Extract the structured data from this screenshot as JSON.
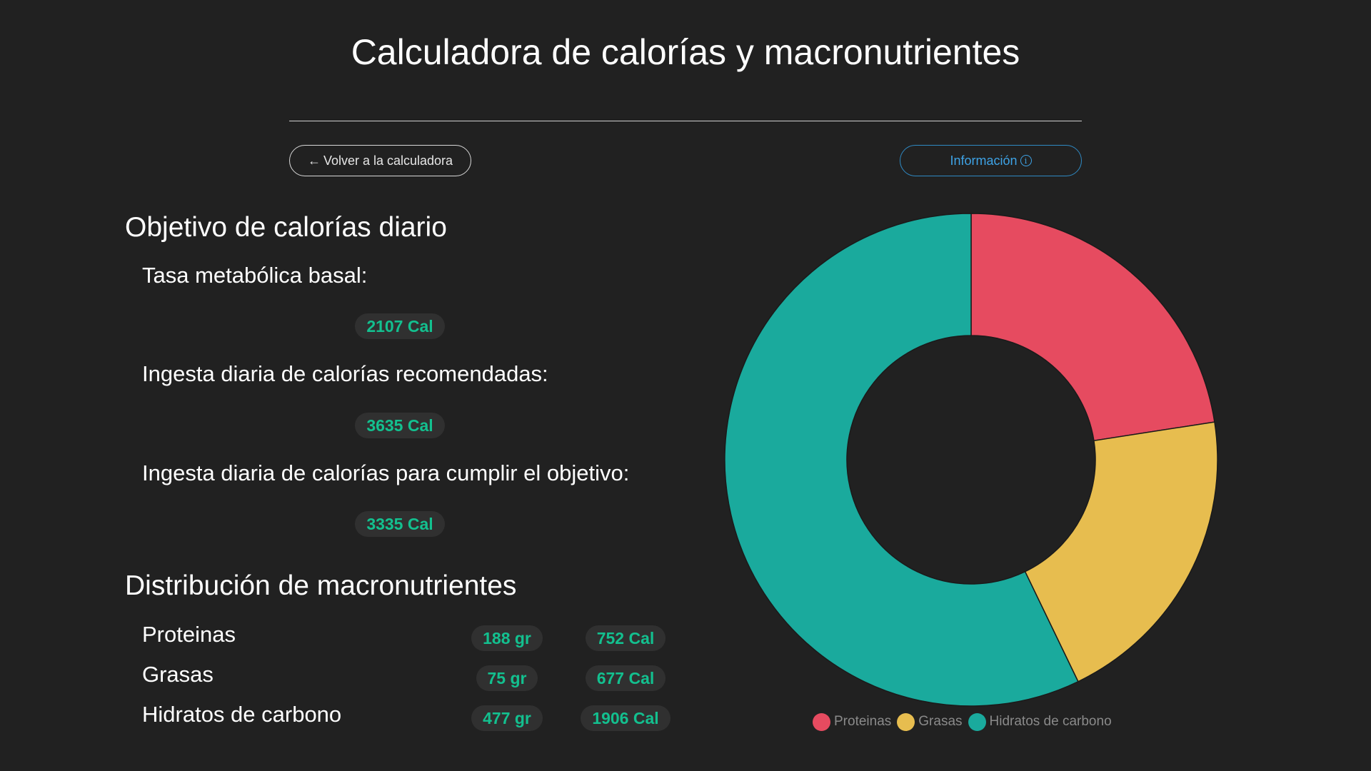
{
  "header": {
    "title": "Calculadora de calorías y macronutrientes"
  },
  "toolbar": {
    "back_label": "Volver a la calculadora",
    "info_label": "Información"
  },
  "icons": {
    "back": "arrow-left-icon",
    "info": "info-circle-icon"
  },
  "calories": {
    "heading": "Objetivo de calorías diario",
    "bmr_label": "Tasa metabólica basal:",
    "bmr_value": "2107 Cal",
    "recommended_label": "Ingesta diaria de calorías recomendadas:",
    "recommended_value": "3635 Cal",
    "goal_label": "Ingesta diaria de calorías para cumplir el objetivo:",
    "goal_value": "3335 Cal"
  },
  "macros": {
    "heading": "Distribución de macronutrientes",
    "rows": [
      {
        "name": "Proteinas",
        "grams": "188 gr",
        "calories": "752 Cal"
      },
      {
        "name": "Grasas",
        "grams": "75 gr",
        "calories": "677 Cal"
      },
      {
        "name": "Hidratos de carbono",
        "grams": "477 gr",
        "calories": "1906 Cal"
      }
    ]
  },
  "colors": {
    "background": "#212121",
    "accent_value": "#13c08f",
    "info_blue": "#3ea3e6",
    "proteinas": "#e64b60",
    "grasas": "#e7bd4f",
    "hidratos": "#1aaa9d"
  },
  "chart_data": {
    "type": "pie",
    "variant": "doughnut",
    "categories": [
      "Proteinas",
      "Grasas",
      "Hidratos de carbono"
    ],
    "values": [
      752,
      677,
      1906
    ],
    "colors": [
      "#e64b60",
      "#e7bd4f",
      "#1aaa9d"
    ],
    "legend": "bottom"
  }
}
